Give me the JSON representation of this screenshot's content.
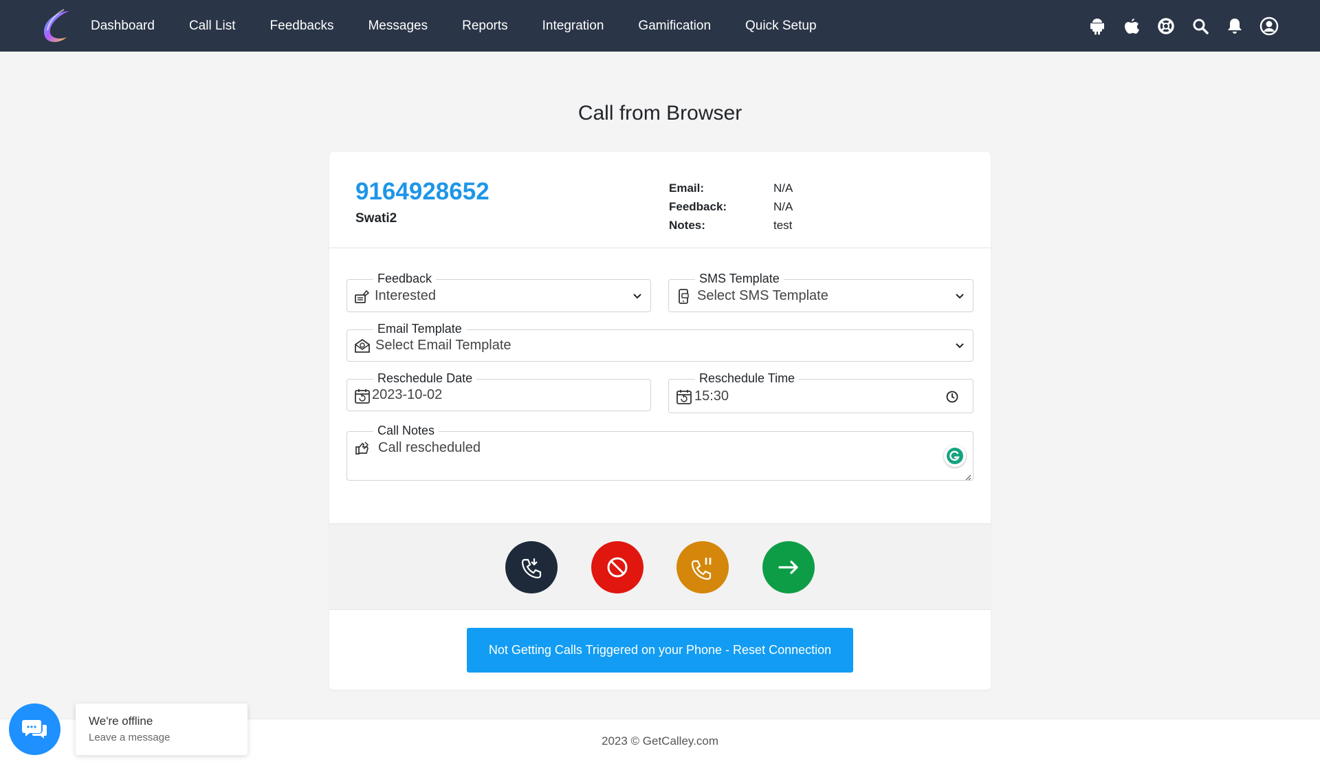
{
  "nav": {
    "links": [
      "Dashboard",
      "Call List",
      "Feedbacks",
      "Messages",
      "Reports",
      "Integration",
      "Gamification",
      "Quick Setup"
    ],
    "icons": [
      "android-icon",
      "apple-icon",
      "help-lifebuoy-icon",
      "search-icon",
      "bell-icon",
      "user-circle-icon"
    ]
  },
  "page": {
    "title": "Call from Browser"
  },
  "contact": {
    "phone": "9164928652",
    "name": "Swati2",
    "email_label": "Email:",
    "email_value": "N/A",
    "feedback_label": "Feedback:",
    "feedback_value": "N/A",
    "notes_label": "Notes:",
    "notes_value": "test"
  },
  "form": {
    "feedback": {
      "label": "Feedback",
      "value": "Interested"
    },
    "sms_template": {
      "label": "SMS Template",
      "value": "Select SMS Template"
    },
    "email_template": {
      "label": "Email Template",
      "value": "Select Email Template"
    },
    "reschedule_date": {
      "label": "Reschedule Date",
      "value": "2023-10-02"
    },
    "reschedule_time": {
      "label": "Reschedule Time",
      "value": "15:30"
    },
    "call_notes": {
      "label": "Call Notes",
      "value": "Call rescheduled"
    }
  },
  "actions": {
    "colors": {
      "call": "#1e2a3a",
      "stop": "#e0160f",
      "pause": "#d4870b",
      "next": "#0e9d47"
    },
    "icons": [
      "phone-incoming-icon",
      "block-icon",
      "phone-pause-icon",
      "arrow-right-icon"
    ]
  },
  "reset_button": {
    "label": "Not Getting Calls Triggered on your Phone - Reset Connection"
  },
  "footer": {
    "text": "2023 © GetCalley.com"
  },
  "chat": {
    "title": "We're offline",
    "subtitle": "Leave a message"
  },
  "colors": {
    "navbar": "#2a3547",
    "accent": "#129cf3",
    "phone": "#1e96e8"
  }
}
